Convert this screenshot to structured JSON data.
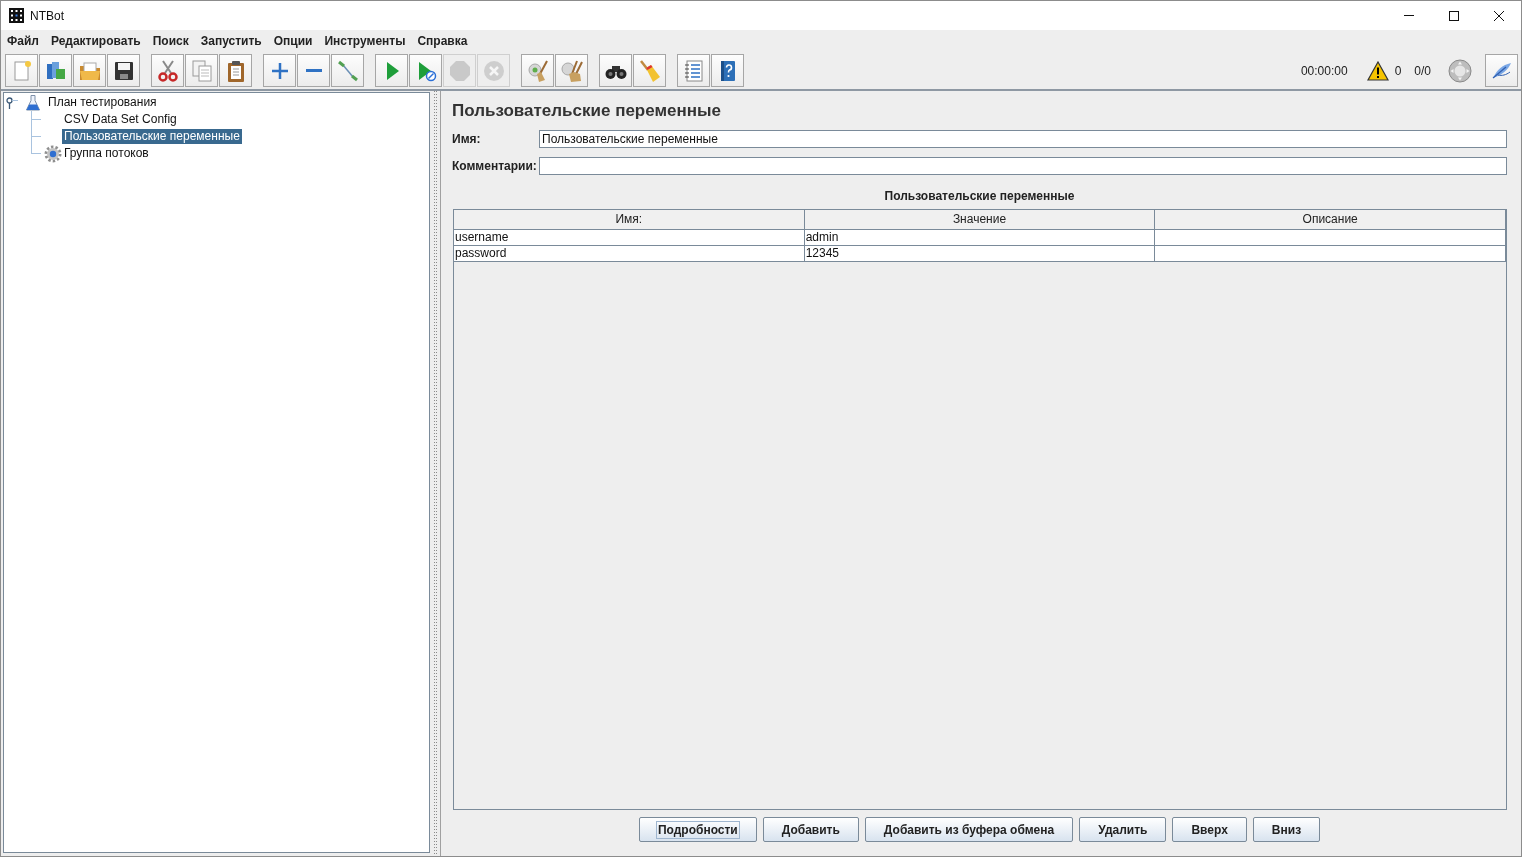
{
  "window": {
    "title": "NTBot"
  },
  "menu": [
    "Файл",
    "Редактировать",
    "Поиск",
    "Запустить",
    "Опции",
    "Инструменты",
    "Справка"
  ],
  "toolbar": {
    "groups": [
      [
        {
          "kind": "new",
          "disabled": false
        },
        {
          "kind": "templates",
          "disabled": false
        },
        {
          "kind": "open",
          "disabled": false
        },
        {
          "kind": "save",
          "disabled": false
        }
      ],
      [
        {
          "kind": "cut",
          "disabled": false
        },
        {
          "kind": "copy",
          "disabled": false
        },
        {
          "kind": "paste",
          "disabled": false
        }
      ],
      [
        {
          "kind": "expand",
          "disabled": false
        },
        {
          "kind": "collapse",
          "disabled": false
        },
        {
          "kind": "toggle",
          "disabled": false
        }
      ],
      [
        {
          "kind": "start",
          "disabled": false
        },
        {
          "kind": "start-no-pause",
          "disabled": false
        },
        {
          "kind": "stop",
          "disabled": true
        },
        {
          "kind": "shutdown",
          "disabled": true
        }
      ],
      [
        {
          "kind": "clear",
          "disabled": false
        },
        {
          "kind": "clear-all",
          "disabled": false
        }
      ],
      [
        {
          "kind": "search",
          "disabled": false
        },
        {
          "kind": "reset-search",
          "disabled": false
        }
      ],
      [
        {
          "kind": "function-helper",
          "disabled": false
        },
        {
          "kind": "help",
          "disabled": false
        }
      ]
    ],
    "timer": "00:00:00",
    "warnings": "0",
    "threads": "0/0"
  },
  "tree": [
    {
      "label": "План тестирования",
      "kind": "test-plan",
      "expanded": true,
      "selected": false,
      "children": [
        {
          "label": "CSV Data Set Config",
          "kind": "config",
          "selected": false
        },
        {
          "label": "Пользовательские переменные",
          "kind": "config",
          "selected": true
        },
        {
          "label": "Группа потоков",
          "kind": "thread-group",
          "selected": false
        }
      ]
    }
  ],
  "editor": {
    "title": "Пользовательские переменные",
    "fields": [
      {
        "label": "Имя:",
        "value": "Пользовательские переменные"
      },
      {
        "label": "Комментарии:"
      }
    ],
    "table": {
      "title": "Пользовательские переменные",
      "columns": [
        "Имя:",
        "Значение",
        "Описание"
      ],
      "rows": [
        [
          "username",
          "admin"
        ],
        [
          "password",
          "12345"
        ]
      ]
    },
    "buttons": [
      {
        "label": "Подробности",
        "focused": true
      },
      {
        "label": "Добавить",
        "focused": false
      },
      {
        "label": "Добавить из буфера обмена",
        "focused": false
      },
      {
        "label": "Удалить",
        "focused": false
      },
      {
        "label": "Вверх",
        "focused": false
      },
      {
        "label": "Вниз",
        "focused": false
      }
    ]
  }
}
